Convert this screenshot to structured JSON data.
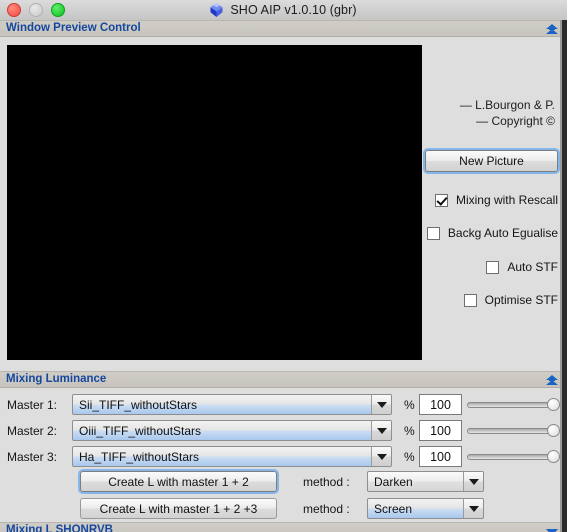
{
  "window": {
    "title": "SHO AIP v1.0.10 (gbr)",
    "app_icon": "blue-gem-icon",
    "controls": {
      "close": "close-button",
      "minimize": "minimize-button",
      "maximize": "maximize-button"
    }
  },
  "colors": {
    "section_title": "#15479e",
    "panel_bg": "#dedede",
    "section_header_bg": "#c9c7c0",
    "preview_bg": "#000000",
    "focus_ring": "#85b6ea",
    "combo_selected": "#a9c8ee"
  },
  "sections": {
    "preview": {
      "title": "Window Preview Control",
      "collapse_icon": "double-chevron-up-icon"
    },
    "luminance": {
      "title": "Mixing Luminance",
      "collapse_icon": "double-chevron-up-icon"
    },
    "shonrvb": {
      "title": "Mixing L SHONRVB",
      "collapse_icon": "chevron-down-icon"
    }
  },
  "credits": {
    "line1": "— L.Bourgon & P.",
    "line2": "— Copyright ©"
  },
  "buttons": {
    "new_picture": "New Picture",
    "create_l_12": "Create L with master 1 + 2",
    "create_l_123": "Create L with master 1 + 2 +3"
  },
  "checkboxes": [
    {
      "label": "Mixing with Rescall",
      "checked": true
    },
    {
      "label": "Backg Auto Egualise",
      "checked": false
    },
    {
      "label": "Auto STF",
      "checked": false
    },
    {
      "label": "Optimise STF",
      "checked": false
    }
  ],
  "masters": [
    {
      "label": "Master 1:",
      "channel": "Sii_TIFF_withoutStars",
      "percent_sign": "%",
      "percent_value": "100",
      "slider_position": "100"
    },
    {
      "label": "Master 2:",
      "channel": "Oiii_TIFF_withoutStars",
      "percent_sign": "%",
      "percent_value": "100",
      "slider_position": "100"
    },
    {
      "label": "Master 3:",
      "channel": "Ha_TIFF_withoutStars",
      "percent_sign": "%",
      "percent_value": "100",
      "slider_position": "100"
    }
  ],
  "create_rows": [
    {
      "button": "Create L with master 1 + 2",
      "method_label": "method :",
      "method_value": "Darken",
      "focused": true
    },
    {
      "button": "Create L with master 1 + 2 +3",
      "method_label": "method :",
      "method_value": "Screen",
      "focused": false
    }
  ]
}
